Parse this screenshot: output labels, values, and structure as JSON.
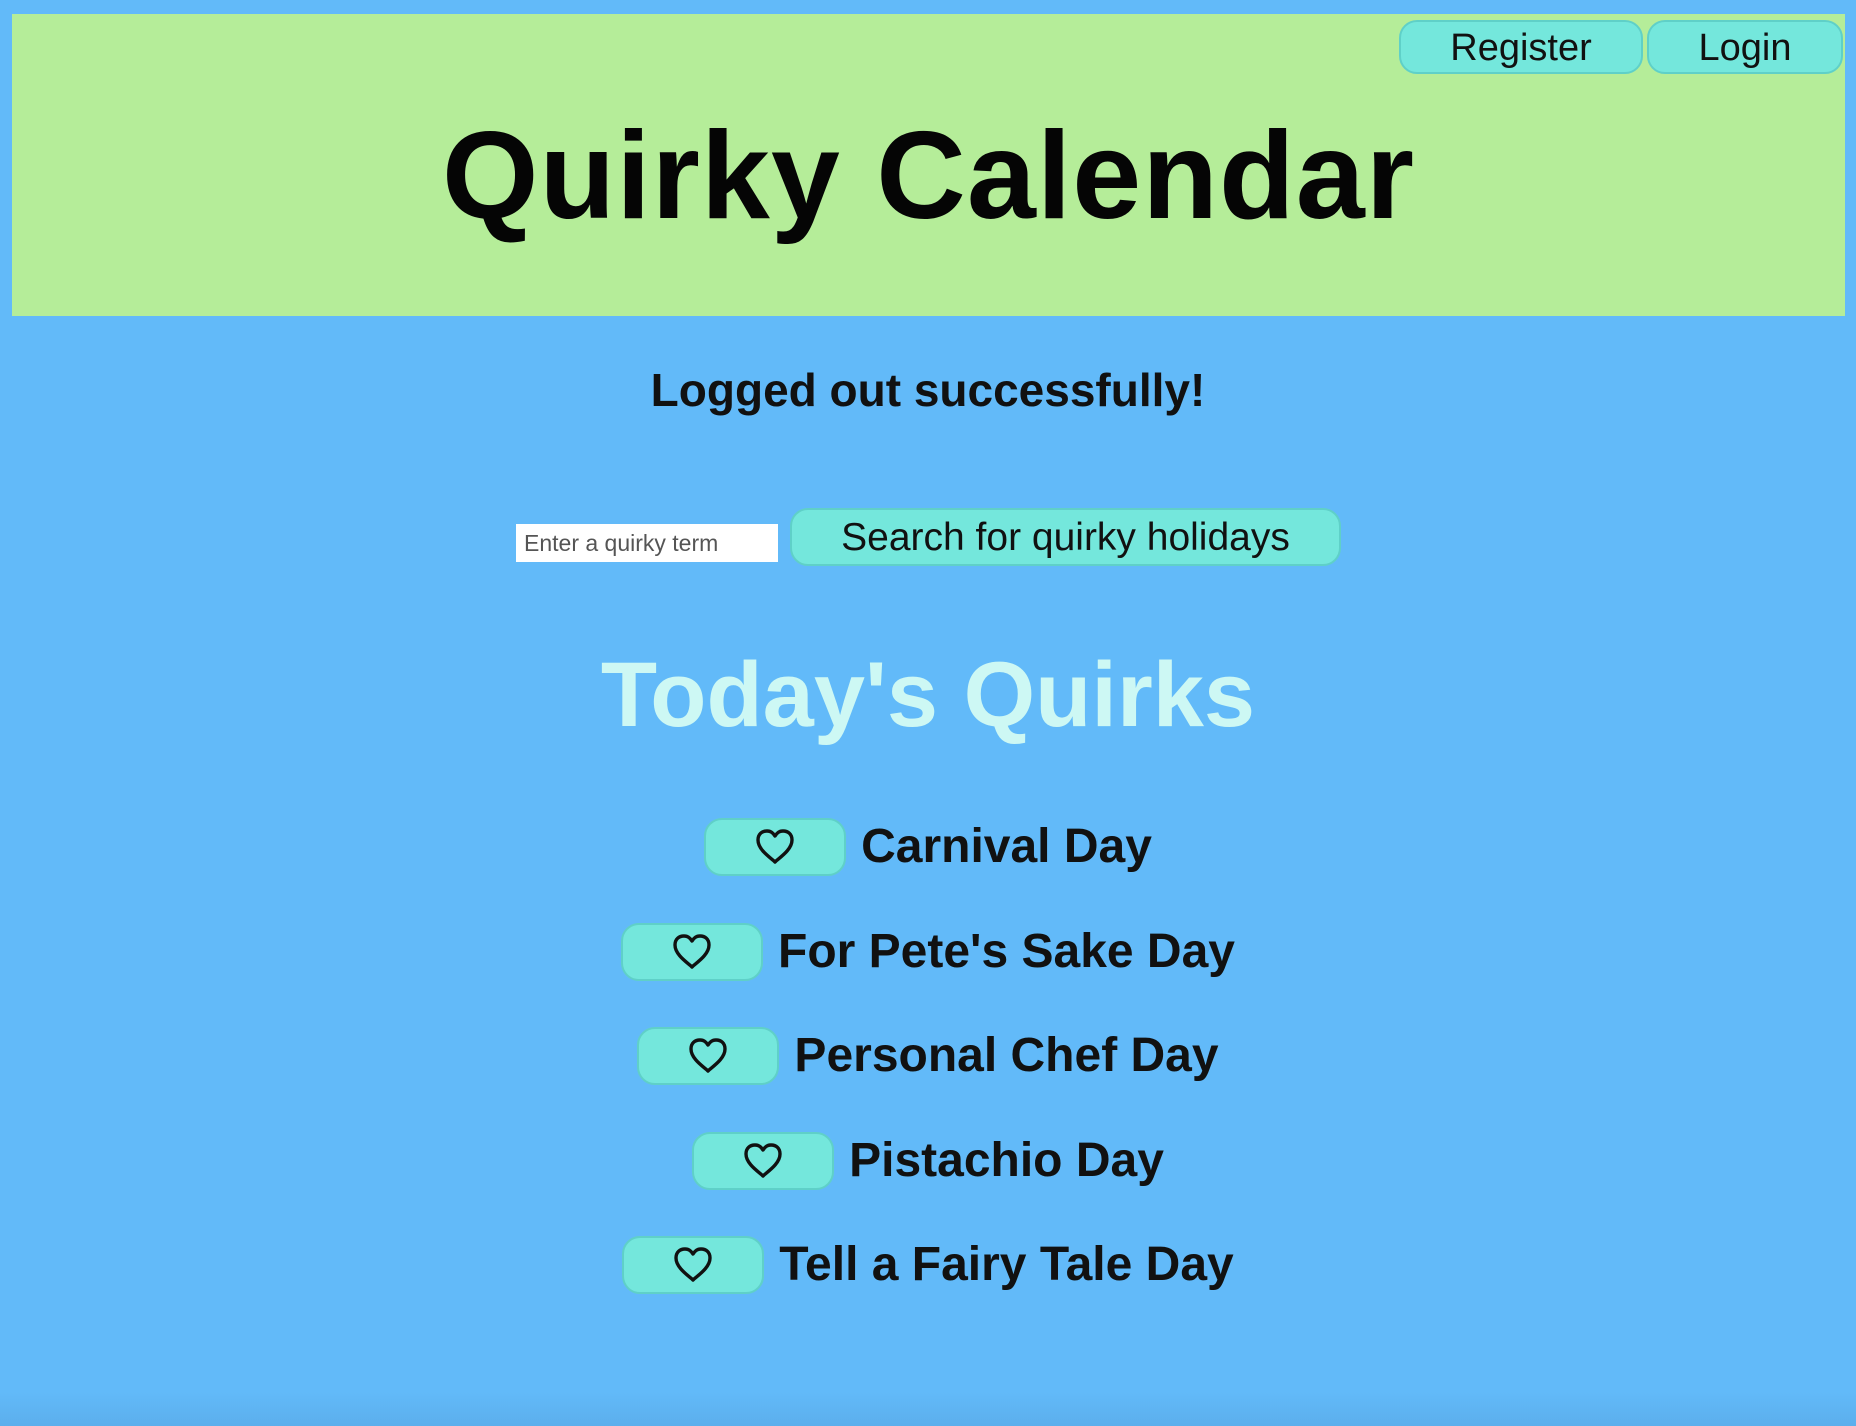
{
  "header": {
    "title": "Quirky Calendar",
    "register_label": "Register",
    "login_label": "Login"
  },
  "message": "Logged out successfully!",
  "search": {
    "placeholder": "Enter a quirky term",
    "value": "",
    "button_label": "Search for quirky holidays"
  },
  "main": {
    "section_title": "Today's Quirks",
    "quirks": [
      {
        "name": "Carnival Day",
        "icon": "heart-outline-icon"
      },
      {
        "name": "For Pete's Sake Day",
        "icon": "heart-outline-icon"
      },
      {
        "name": "Personal Chef Day",
        "icon": "heart-outline-icon"
      },
      {
        "name": "Pistachio Day",
        "icon": "heart-outline-icon"
      },
      {
        "name": "Tell a Fairy Tale Day",
        "icon": "heart-outline-icon"
      }
    ]
  },
  "colors": {
    "page_background": "#62baf9",
    "header_background": "#b5ed99",
    "button_background": "#74e7dc",
    "section_title": "#cdf8f4",
    "text": "#111111"
  }
}
